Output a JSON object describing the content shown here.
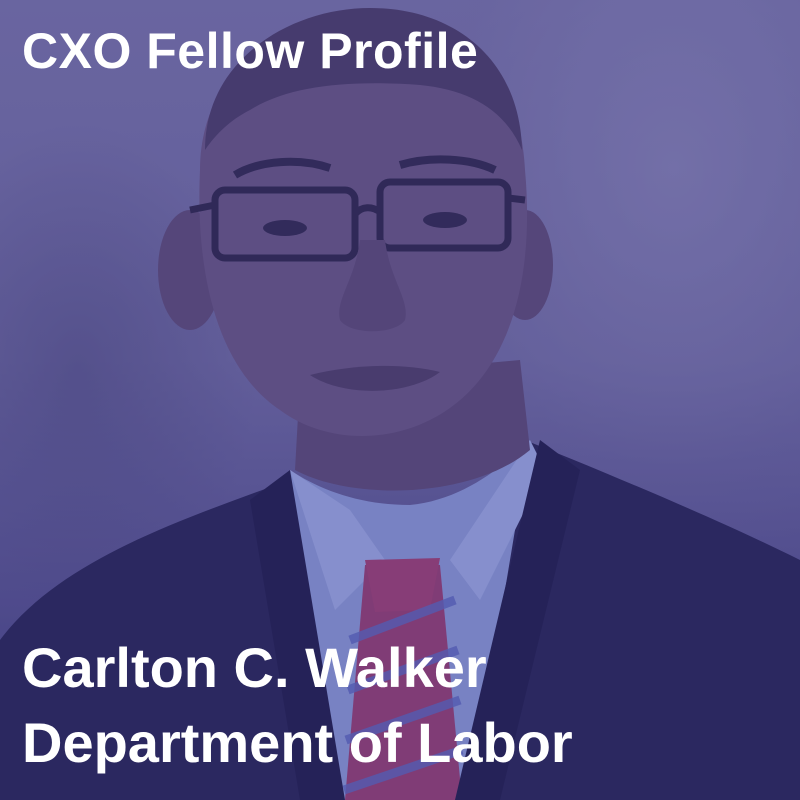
{
  "card": {
    "title": "CXO Fellow Profile",
    "name": "Carlton C. Walker",
    "department": "Department of Labor",
    "overlay_color": "#3c378c",
    "text_color": "#ffffff"
  },
  "photo": {
    "subject": "portrait-photo"
  }
}
